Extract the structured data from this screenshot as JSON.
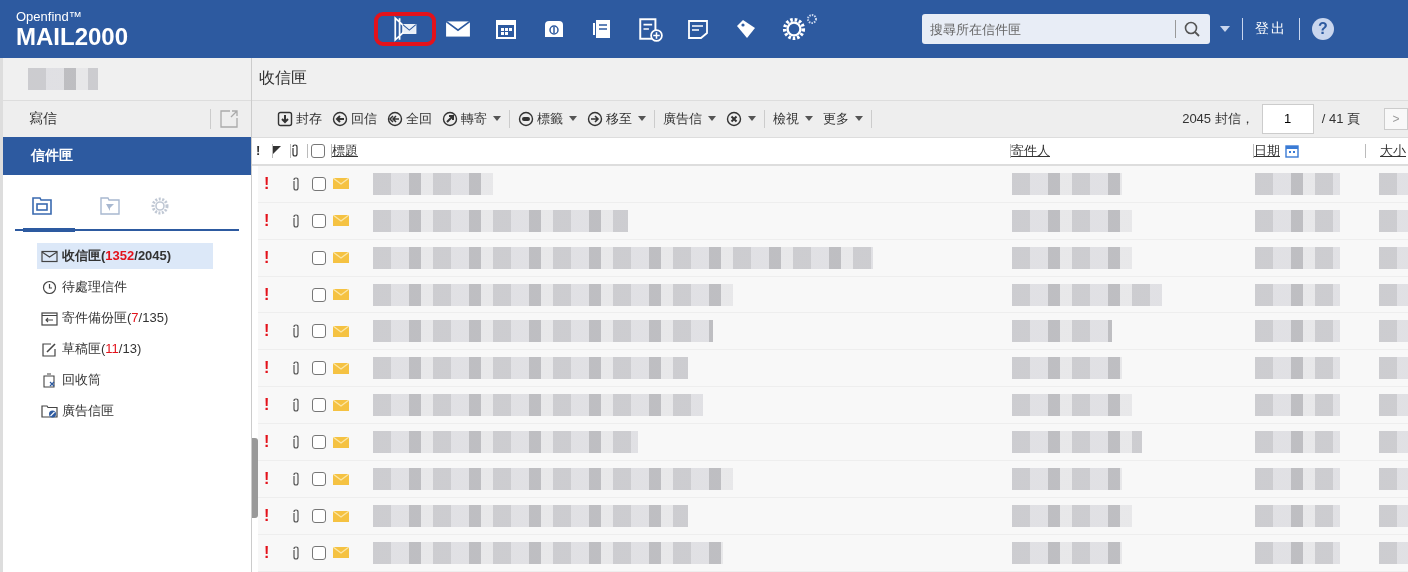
{
  "brand": {
    "top": "Openfind™",
    "name": "MAIL2000"
  },
  "nav_icons": [
    {
      "kind": "send",
      "highlighted": true
    },
    {
      "kind": "mail",
      "highlighted": false
    },
    {
      "kind": "calendar",
      "highlighted": false
    },
    {
      "kind": "drive",
      "highlighted": false
    },
    {
      "kind": "contacts",
      "highlighted": false
    },
    {
      "kind": "add-note",
      "highlighted": false
    },
    {
      "kind": "note",
      "highlighted": false
    },
    {
      "kind": "tag",
      "highlighted": false
    },
    {
      "kind": "gear",
      "highlighted": false
    },
    {
      "kind": "small-gear",
      "highlighted": false
    }
  ],
  "search": {
    "placeholder": "搜尋所在信件匣"
  },
  "logout": "登出",
  "help": "?",
  "folder_title": "收信匣",
  "sidebar": {
    "compose": "寫信",
    "mailbox": "信件匣",
    "tabs": [
      {
        "kind": "folder",
        "selected": true
      },
      {
        "kind": "filter",
        "selected": false
      },
      {
        "kind": "settings",
        "selected": false
      }
    ],
    "folders": [
      {
        "kind": "inbox",
        "name": "收信匣(",
        "unread": "1352",
        "rest": "/2045)",
        "selected": true
      },
      {
        "kind": "pending",
        "name": "待處理信件",
        "selected": false
      },
      {
        "kind": "sent",
        "name": "寄件備份匣(",
        "unread": "7",
        "rest": "/135)",
        "selected": false
      },
      {
        "kind": "drafts",
        "name": "草稿匣(",
        "unread": "11",
        "rest": "/13)",
        "selected": false
      },
      {
        "kind": "trash",
        "name": "回收筒",
        "selected": false
      },
      {
        "kind": "spam",
        "name": "廣告信匣",
        "selected": false
      }
    ]
  },
  "toolbar": [
    {
      "kind": "archive",
      "label": "封存",
      "dropdown": false
    },
    {
      "kind": "reply",
      "label": "回信",
      "dropdown": false
    },
    {
      "kind": "replyall",
      "label": "全回",
      "dropdown": false
    },
    {
      "kind": "forward",
      "label": "轉寄",
      "dropdown": true
    },
    {
      "kind": "separator"
    },
    {
      "kind": "label",
      "label": "標籤",
      "dropdown": true
    },
    {
      "kind": "move",
      "label": "移至",
      "dropdown": true
    },
    {
      "kind": "separator"
    },
    {
      "kind": "text",
      "label": "廣告信",
      "dropdown": true
    },
    {
      "kind": "delete",
      "dropdown": true
    },
    {
      "kind": "separator"
    },
    {
      "kind": "text",
      "label": "檢視",
      "dropdown": true
    },
    {
      "kind": "text",
      "label": "更多",
      "dropdown": true
    },
    {
      "kind": "separator"
    }
  ],
  "pager": {
    "count": "2045 封信，",
    "page": "1",
    "pages": "/ 41 頁",
    "next": ">"
  },
  "columns": {
    "important": "!",
    "select_all_checked": false,
    "subject": "標題",
    "sender": "寄件人",
    "date": "日期",
    "size": "大小"
  },
  "rows": [
    {
      "priority": "!",
      "attachment": true,
      "checked": false
    },
    {
      "priority": "!",
      "attachment": true,
      "checked": false
    },
    {
      "priority": "!",
      "attachment": false,
      "checked": false
    },
    {
      "priority": "!",
      "attachment": false,
      "checked": false
    },
    {
      "priority": "!",
      "attachment": true,
      "checked": false
    },
    {
      "priority": "!",
      "attachment": true,
      "checked": false
    },
    {
      "priority": "!",
      "attachment": true,
      "checked": false
    },
    {
      "priority": "!",
      "attachment": true,
      "checked": false
    },
    {
      "priority": "!",
      "attachment": true,
      "checked": false
    },
    {
      "priority": "!",
      "attachment": true,
      "checked": false
    },
    {
      "priority": "!",
      "attachment": true,
      "checked": false
    }
  ]
}
